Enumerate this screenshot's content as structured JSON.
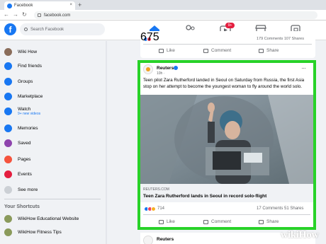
{
  "browser": {
    "tab_title": "Facebook",
    "tab_close": "×",
    "new_tab": "+",
    "url": "facebook.com"
  },
  "header": {
    "logo": "f",
    "search_placeholder": "Search Facebook",
    "watch_badge": "9+",
    "nav_icons": [
      "home-icon",
      "friends-icon",
      "watch-icon",
      "marketplace-icon",
      "gaming-icon"
    ],
    "accent": "#1877f2"
  },
  "sidebar": {
    "items": [
      {
        "label": "Wiki How",
        "color": "#8a6d5a"
      },
      {
        "label": "Find friends",
        "color": "#1877f2"
      },
      {
        "label": "Groups",
        "color": "#1877f2"
      },
      {
        "label": "Marketplace",
        "color": "#1877f2"
      },
      {
        "label": "Watch",
        "sub": "9+ new videos",
        "color": "#1877f2"
      },
      {
        "label": "Memories",
        "color": "#1877f2"
      },
      {
        "label": "Saved",
        "color": "#8e44ad"
      },
      {
        "label": "Pages",
        "color": "#f5533d"
      },
      {
        "label": "Events",
        "color": "#e41e3f"
      },
      {
        "label": "See more",
        "color": "#ccd0d5"
      }
    ],
    "shortcuts_title": "Your Shortcuts",
    "shortcuts": [
      {
        "label": "WikiHow Educational Website"
      },
      {
        "label": "WikiHow Fitness Tips"
      }
    ]
  },
  "prev_post": {
    "reactions_count": "675",
    "stats": "179 Comments  107 Shares",
    "like": "Like",
    "comment": "Comment",
    "share": "Share"
  },
  "post": {
    "author": "Reuters",
    "time": "10h · ",
    "menu": "···",
    "text": "Teen pilot Zara Rutherford landed in Seoul on Saturday from Russia, the first Asia stop on her attempt to become the youngest woman to fly around the world solo.",
    "link_domain": "REUTERS.COM",
    "link_title": "Teen Zara Rutherford lands in Seoul in record solo-flight",
    "reactions_count": "714",
    "stats": "17 Comments  51 Shares",
    "like": "Like",
    "comment": "Comment",
    "share": "Share",
    "highlight_color": "#28d228"
  },
  "next_post": {
    "author": "Reuters"
  },
  "watermark": "wikiHow"
}
